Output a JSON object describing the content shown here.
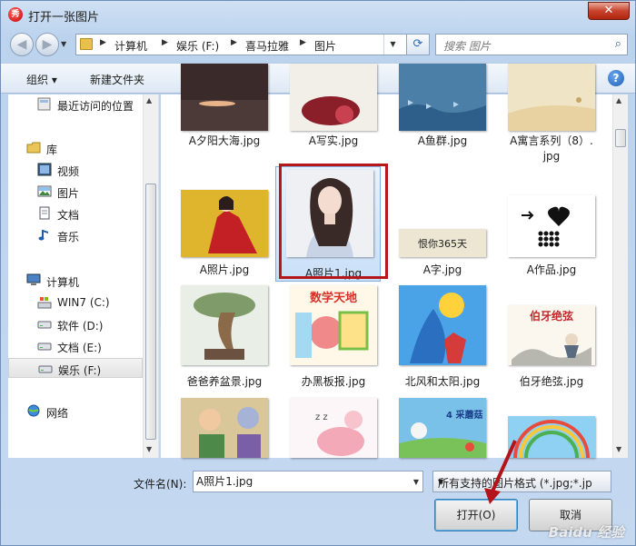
{
  "window": {
    "title": "打开一张图片",
    "app_icon_glyph": "秀",
    "close_glyph": "✕"
  },
  "nav": {
    "back_glyph": "◀",
    "forward_glyph": "▶",
    "breadcrumbs": [
      "计算机",
      "娱乐 (F:)",
      "喜马拉雅",
      "图片"
    ],
    "refresh_glyph": "⟳",
    "search_placeholder": "搜索 图片",
    "search_glyph": "⌕"
  },
  "toolbar": {
    "organize": "组织 ▾",
    "new_folder": "新建文件夹"
  },
  "sidebar": {
    "items": [
      {
        "label": "最近访问的位置",
        "icon": "recent-places-icon"
      },
      {
        "label": "库",
        "icon": "library-icon"
      },
      {
        "label": "视频",
        "icon": "video-library-icon"
      },
      {
        "label": "图片",
        "icon": "picture-library-icon"
      },
      {
        "label": "文档",
        "icon": "document-library-icon"
      },
      {
        "label": "音乐",
        "icon": "music-library-icon"
      },
      {
        "label": "计算机",
        "icon": "computer-icon"
      },
      {
        "label": "WIN7 (C:)",
        "icon": "system-drive-icon"
      },
      {
        "label": "软件 (D:)",
        "icon": "drive-icon"
      },
      {
        "label": "文档 (E:)",
        "icon": "drive-icon"
      },
      {
        "label": "娱乐 (F:)",
        "icon": "drive-icon"
      },
      {
        "label": "网络",
        "icon": "network-icon"
      }
    ]
  },
  "files": [
    {
      "name": "A夕阳大海.jpg"
    },
    {
      "name": "A写实.jpg"
    },
    {
      "name": "A鱼群.jpg"
    },
    {
      "name": "A寓言系列（8）.",
      "name2": "jpg"
    },
    {
      "name": "A照片.jpg"
    },
    {
      "name": "A照片1.jpg",
      "selected": true
    },
    {
      "name": "A字.jpg"
    },
    {
      "name": "A作品.jpg"
    },
    {
      "name": "爸爸养盆景.jpg"
    },
    {
      "name": "办黑板报.jpg"
    },
    {
      "name": "北风和太阳.jpg"
    },
    {
      "name": "伯牙绝弦.jpg"
    },
    {
      "name": ""
    },
    {
      "name": ""
    },
    {
      "name": ""
    },
    {
      "name": ""
    }
  ],
  "thumb_text": {
    "a_zi": "恨你365天",
    "banbao": "数学天地",
    "boya": "伯牙绝弦",
    "beifeng": "4 采蘑菇"
  },
  "bottom": {
    "filename_label": "文件名(N):",
    "filename_value": "A照片1.jpg",
    "filter_label": "所有支持的图片格式 (*.jpg;*.jp",
    "open_button": "打开(O)",
    "cancel_button": "取消"
  },
  "watermark": "Baidu 经验"
}
